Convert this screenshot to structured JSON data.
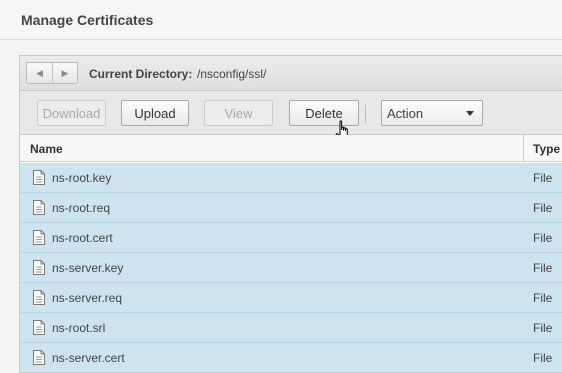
{
  "header": {
    "title": "Manage Certificates"
  },
  "nav": {
    "back_icon": "chevron-left-icon",
    "forward_icon": "chevron-right-icon"
  },
  "directory": {
    "label": "Current Directory:",
    "value": "/nsconfig/ssl/"
  },
  "toolbar": {
    "download_label": "Download",
    "upload_label": "Upload",
    "view_label": "View",
    "delete_label": "Delete",
    "action_selected": "Action"
  },
  "table": {
    "columns": {
      "name": "Name",
      "type": "Type"
    },
    "rows": [
      {
        "name": "ns-root.key",
        "type": "File"
      },
      {
        "name": "ns-root.req",
        "type": "File"
      },
      {
        "name": "ns-root.cert",
        "type": "File"
      },
      {
        "name": "ns-server.key",
        "type": "File"
      },
      {
        "name": "ns-server.req",
        "type": "File"
      },
      {
        "name": "ns-root.srl",
        "type": "File"
      },
      {
        "name": "ns-server.cert",
        "type": "File"
      }
    ],
    "row_icon": "file-icon"
  },
  "colors": {
    "row_selected": "#cde4f0",
    "row_border": "#b9d6e6"
  }
}
